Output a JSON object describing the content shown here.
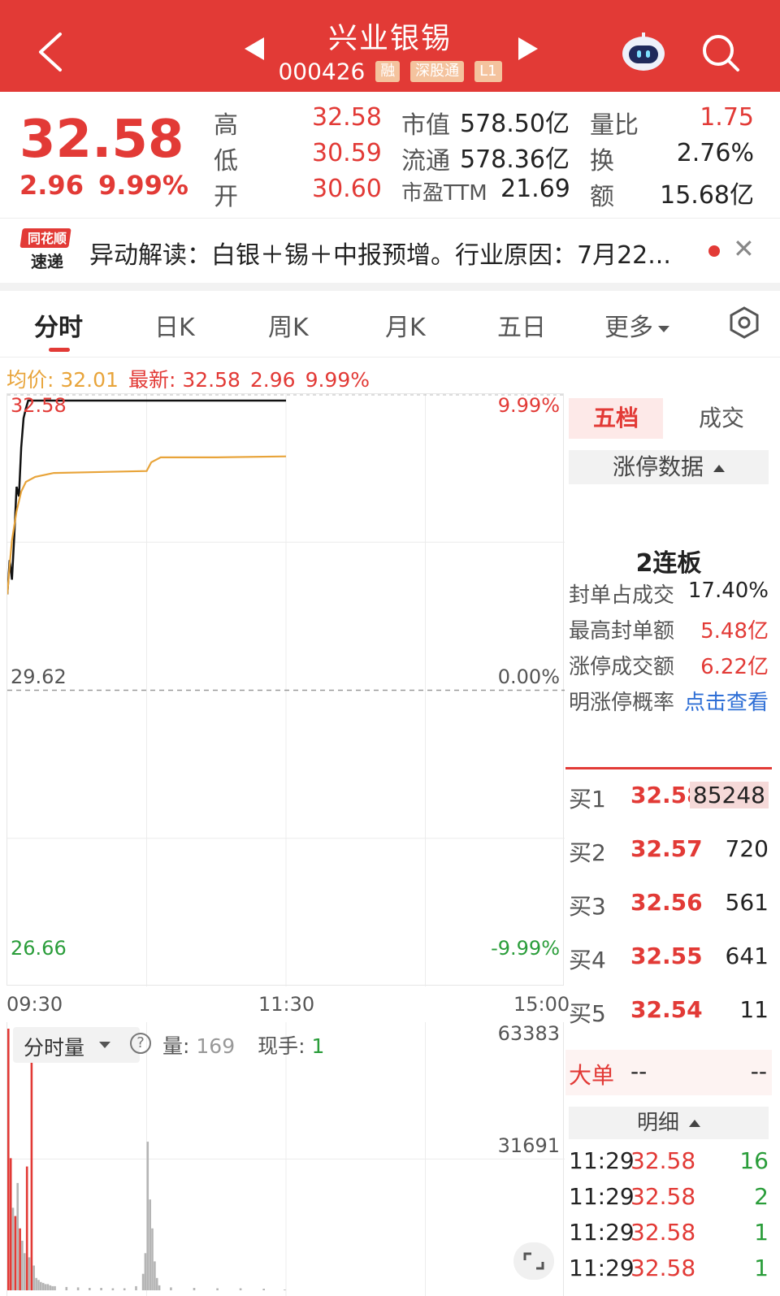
{
  "header": {
    "title": "兴业银锡",
    "code": "000426",
    "tags": [
      "融",
      "深股通",
      "L1"
    ],
    "colors": {
      "bar": "#e23a36"
    }
  },
  "quote": {
    "price": "32.58",
    "change": "2.96",
    "change_pct": "9.99%",
    "stats": [
      {
        "label": "高",
        "value": "32.58"
      },
      {
        "label": "低",
        "value": "30.59"
      },
      {
        "label": "开",
        "value": "30.60"
      },
      {
        "label": "市值",
        "value": "578.50亿"
      },
      {
        "label": "流通",
        "value": "578.36亿"
      },
      {
        "label": "市盈TTM",
        "value": "21.69"
      },
      {
        "label": "量比",
        "value": "1.75"
      },
      {
        "label": "换",
        "value": "2.76%"
      },
      {
        "label": "额",
        "value": "15.68亿"
      }
    ]
  },
  "news": {
    "logo_top": "同花顺",
    "logo_bottom": "速递",
    "text": "异动解读：白银＋锡＋中报预增。行业原因：7月22..."
  },
  "tabs": [
    "分时",
    "日K",
    "周K",
    "月K",
    "五日",
    "更多"
  ],
  "legend": {
    "avg": "均价: 32.01",
    "latest": "最新: 32.58",
    "change": "2.96",
    "change_pct": "9.99%"
  },
  "chart_data": {
    "type": "line",
    "title": "",
    "y_ticks_left": [
      "32.58",
      "29.62",
      "26.66"
    ],
    "y_ticks_right": [
      "9.99%",
      "0.00%",
      "-9.99%"
    ],
    "x_ticks": [
      "09:30",
      "11:30",
      "15:00"
    ],
    "ylim": [
      26.66,
      32.58
    ],
    "series": [
      {
        "name": "最新",
        "color": "#111111",
        "x": [
          "09:30",
          "09:31",
          "09:32",
          "09:33",
          "09:34",
          "09:35",
          "09:36",
          "09:37",
          "09:38",
          "09:39",
          "09:40",
          "09:41",
          "09:42",
          "10:00",
          "10:30",
          "11:00",
          "11:30"
        ],
        "values": [
          30.6,
          30.95,
          30.75,
          31.2,
          31.7,
          31.6,
          32.1,
          32.4,
          32.5,
          32.58,
          32.58,
          32.58,
          32.58,
          32.58,
          32.58,
          32.58,
          32.58
        ]
      },
      {
        "name": "均价",
        "color": "#e8a43a",
        "x": [
          "09:30",
          "09:31",
          "09:32",
          "09:34",
          "09:36",
          "09:38",
          "09:42",
          "09:50",
          "10:30",
          "10:32",
          "10:36",
          "11:00",
          "11:30"
        ],
        "values": [
          30.6,
          30.9,
          31.15,
          31.45,
          31.65,
          31.75,
          31.8,
          31.84,
          31.86,
          31.95,
          32.0,
          32.0,
          32.01
        ]
      }
    ]
  },
  "volume": {
    "selector": "分时量",
    "qty_label": "量:",
    "qty_value": "169",
    "hand_label": "现手:",
    "hand_value": "1",
    "y_ticks": [
      "63383",
      "31691"
    ],
    "bars_minutes": [
      0,
      1,
      2,
      3,
      4,
      5,
      6,
      7,
      8,
      9,
      10,
      11,
      12,
      13,
      14,
      15,
      16,
      17,
      18,
      19,
      20,
      25,
      30,
      35,
      40,
      45,
      50,
      55,
      58,
      59,
      60,
      61,
      62,
      63,
      64,
      65,
      70,
      80,
      90,
      100,
      110,
      119
    ],
    "bars_values": [
      63383,
      32000,
      20000,
      18000,
      26000,
      15000,
      12000,
      9000,
      30000,
      8000,
      58000,
      6000,
      3000,
      2500,
      2000,
      1800,
      1500,
      1500,
      1200,
      1000,
      1000,
      800,
      700,
      600,
      600,
      500,
      500,
      1000,
      4000,
      9000,
      36000,
      22000,
      15000,
      7000,
      3000,
      1200,
      700,
      600,
      500,
      500,
      400,
      169
    ],
    "bars_colors": [
      "red",
      "red",
      "gray",
      "red",
      "gray",
      "red",
      "gray",
      "gray",
      "red",
      "gray",
      "red",
      "gray",
      "gray",
      "gray",
      "gray",
      "gray",
      "gray",
      "gray",
      "gray",
      "gray",
      "gray",
      "gray",
      "gray",
      "gray",
      "gray",
      "gray",
      "gray",
      "gray",
      "gray",
      "gray",
      "gray",
      "gray",
      "gray",
      "gray",
      "gray",
      "gray",
      "gray",
      "gray",
      "gray",
      "gray",
      "gray",
      "gray"
    ]
  },
  "panel": {
    "tab_active": "五档",
    "tab_other": "成交",
    "limit_header": "涨停数据",
    "lianban": "2连板",
    "rows": [
      {
        "label": "封单占成交",
        "value": "17.40%"
      },
      {
        "label": "最高封单额",
        "value": "5.48亿"
      },
      {
        "label": "涨停成交额",
        "value": "6.22亿"
      },
      {
        "label": "明涨停概率",
        "value": "点击查看"
      }
    ],
    "bids": [
      {
        "name": "买1",
        "price": "32.58",
        "qty": "85248"
      },
      {
        "name": "买2",
        "price": "32.57",
        "qty": "720"
      },
      {
        "name": "买3",
        "price": "32.56",
        "qty": "561"
      },
      {
        "name": "买4",
        "price": "32.55",
        "qty": "641"
      },
      {
        "name": "买5",
        "price": "32.54",
        "qty": "11"
      }
    ],
    "big_order_label": "大单",
    "big_order_a": "--",
    "big_order_b": "--",
    "detail_header": "明细",
    "ticks": [
      {
        "time": "11:29",
        "price": "32.58",
        "qty": "16"
      },
      {
        "time": "11:29",
        "price": "32.58",
        "qty": "2"
      },
      {
        "time": "11:29",
        "price": "32.58",
        "qty": "1"
      },
      {
        "time": "11:29",
        "price": "32.58",
        "qty": "1"
      }
    ]
  }
}
